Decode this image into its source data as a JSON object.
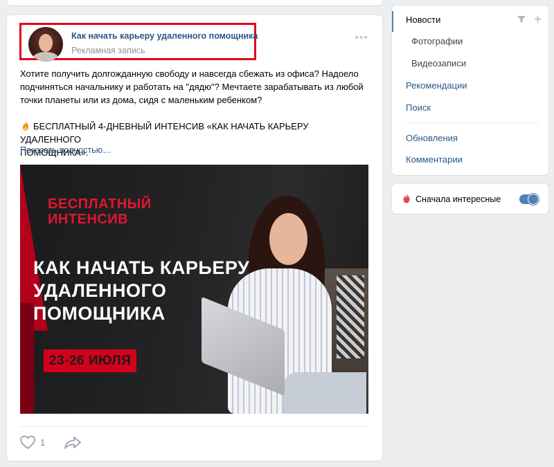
{
  "post": {
    "author": "Как начать карьеру удаленного помощника",
    "ad_label": "Рекламная запись",
    "more_icon": "more-horizontal-icon",
    "text_lines": [
      "Хотите получить долгожданную свободу и навсегда сбежать из офиса? Надоело",
      "подчиняться начальнику и работать на \"дядю\"? Мечтаете зарабатывать из любой",
      "точки планеты или из дома, сидя с маленьким ребенком?"
    ],
    "promo_lines": [
      "БЕСПЛАТНЫЙ 4-ДНЕВНЫЙ ИНТЕНСИВ «КАК НАЧАТЬ КАРЬЕРУ УДАЛЕННОГО",
      "ПОМОЩНИКА»."
    ],
    "show_more": "Показать полностью…",
    "banner": {
      "red_title_1": "БЕСПЛАТНЫЙ",
      "red_title_2": "ИНТЕНСИВ",
      "main_title_1": "КАК НАЧАТЬ КАРЬЕРУ",
      "main_title_2": "УДАЛЕННОГО",
      "main_title_3": "ПОМОЩНИКА",
      "date": "23-26 ИЮЛЯ"
    },
    "likes": "1",
    "highlight_color": "#e0001b"
  },
  "menu": {
    "items": [
      {
        "label": "Новости",
        "active": true
      },
      {
        "label": "Фотографии"
      },
      {
        "label": "Видеозаписи"
      },
      {
        "label": "Рекомендации"
      },
      {
        "label": "Поиск"
      },
      {
        "label": "Обновления"
      },
      {
        "label": "Комментарии"
      }
    ]
  },
  "toggle": {
    "label": "Сначала интересные",
    "on": true
  },
  "colors": {
    "link": "#2a5885",
    "accent": "#5181b8",
    "background": "#edeef0"
  }
}
